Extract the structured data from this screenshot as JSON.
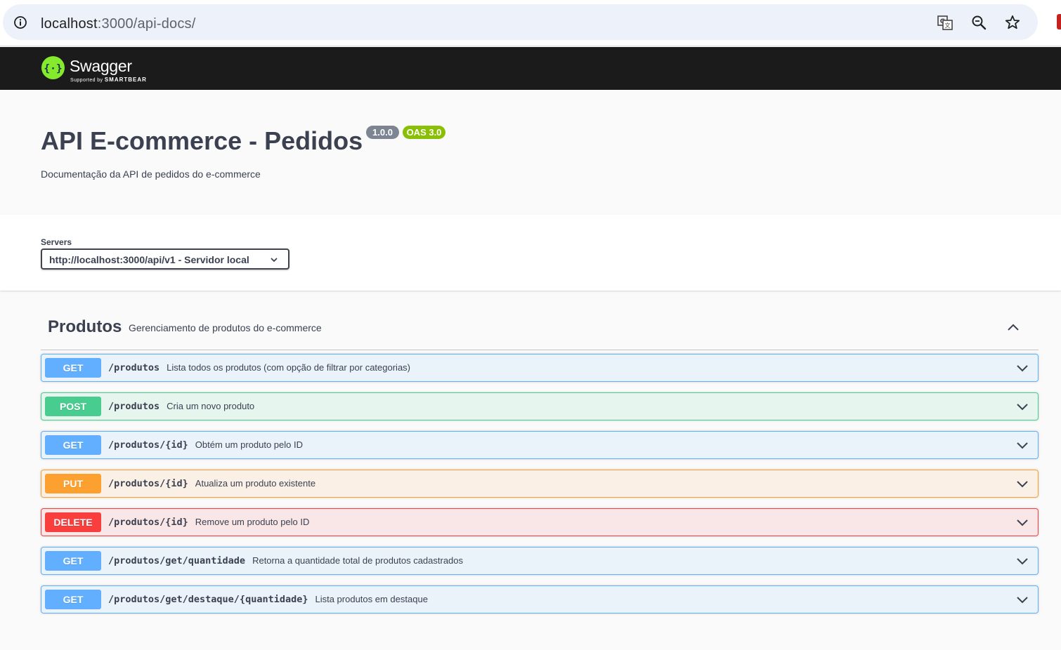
{
  "browser": {
    "url_host": "localhost",
    "url_rest": ":3000/api-docs/"
  },
  "topbar": {
    "logo_text": "Swagger",
    "logo_sub_prefix": "Supported by",
    "logo_sub_brand": "SMARTBEAR"
  },
  "info": {
    "title": "API E-commerce - Pedidos",
    "version_badge": "1.0.0",
    "oas_badge": "OAS 3.0",
    "description": "Documentação da API de pedidos do e-commerce"
  },
  "servers": {
    "label": "Servers",
    "selected": "http://localhost:3000/api/v1 - Servidor local"
  },
  "tag": {
    "name": "Produtos",
    "description": "Gerenciamento de produtos do e-commerce"
  },
  "operations": [
    {
      "method": "GET",
      "path": "/produtos",
      "summary": "Lista todos os produtos (com opção de filtrar por categorias)"
    },
    {
      "method": "POST",
      "path": "/produtos",
      "summary": "Cria um novo produto"
    },
    {
      "method": "GET",
      "path": "/produtos/{id}",
      "summary": "Obtém um produto pelo ID"
    },
    {
      "method": "PUT",
      "path": "/produtos/{id}",
      "summary": "Atualiza um produto existente"
    },
    {
      "method": "DELETE",
      "path": "/produtos/{id}",
      "summary": "Remove um produto pelo ID"
    },
    {
      "method": "GET",
      "path": "/produtos/get/quantidade",
      "summary": "Retorna a quantidade total de produtos cadastrados"
    },
    {
      "method": "GET",
      "path": "/produtos/get/destaque/{quantidade}",
      "summary": "Lista produtos em destaque"
    }
  ],
  "colors": {
    "get": "#61affe",
    "post": "#49cc90",
    "put": "#fca130",
    "delete": "#f93e3e",
    "topbar": "#1b1b1b",
    "logo_green": "#85ea2d"
  },
  "icons": {
    "site_info": "info-icon",
    "translate": "translate-icon",
    "zoom": "zoom-icon",
    "bookmark": "star-icon",
    "collapse": "chevron-up-icon",
    "expand": "chevron-down-icon"
  }
}
